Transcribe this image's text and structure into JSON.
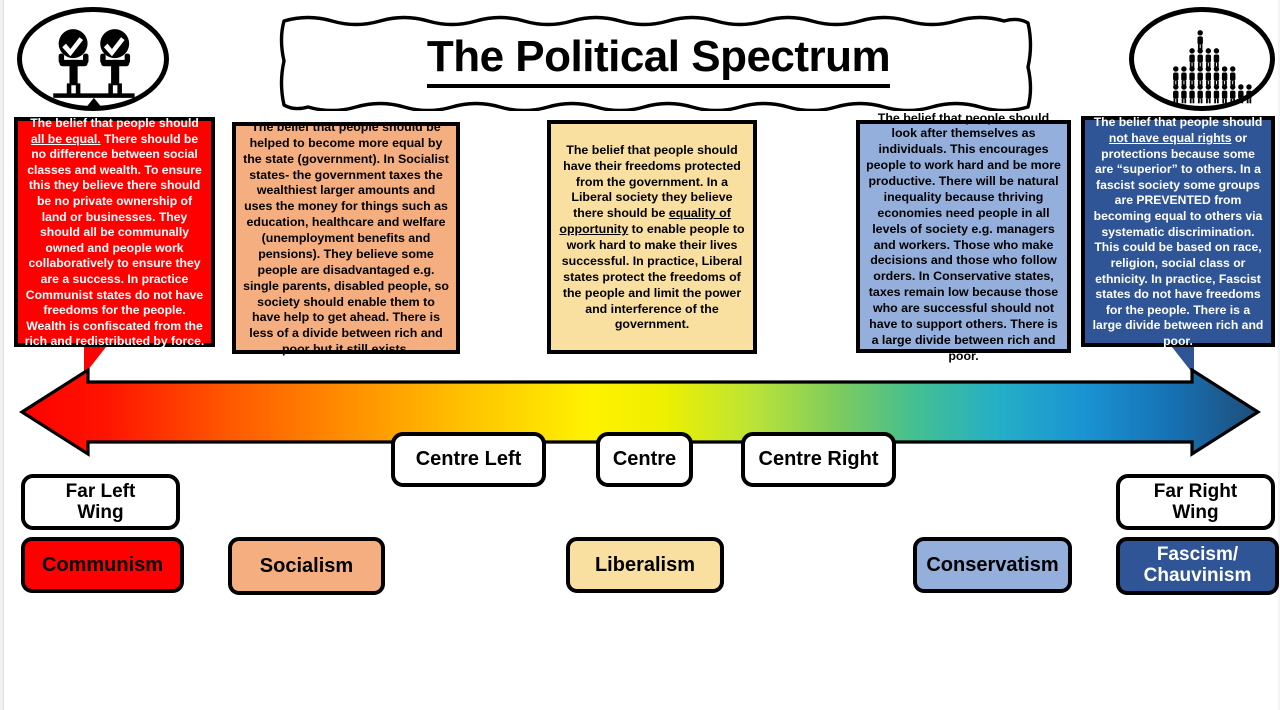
{
  "header": {
    "title": "The Political Spectrum",
    "left_icon": "equality-scales-icon",
    "right_icon": "social-hierarchy-pyramid-icon"
  },
  "descriptions": [
    {
      "id": "communism",
      "color": "#FF0000",
      "text_color": "#FFFFFF",
      "underlined_phrase": "all be equal.",
      "lead": "The belief that people should ",
      "rest": " There should be no difference between social classes and wealth. To ensure this they believe there should be no private ownership of land or businesses. They should all be communally owned and people work collaboratively to ensure they are a success. In practice Communist states do not have freedoms for the people. Wealth is confiscated from the rich and redistributed by force."
    },
    {
      "id": "socialism",
      "color": "#F4AE7F",
      "text_color": "#000000",
      "underlined_phrase": "",
      "lead": "The belief that people should be helped to become more equal by the state (government). In Socialist states- the government taxes the wealthiest larger amounts and uses the money for things such as education, healthcare and welfare (unemployment benefits and pensions). They believe some people are disadvantaged e.g. single parents, disabled people, so society should enable them to have help to get ahead. There is less of a divide between rich and poor but it still exists.",
      "rest": ""
    },
    {
      "id": "liberalism",
      "color": "#F9E0A0",
      "text_color": "#000000",
      "underlined_phrase": "equality of opportunity",
      "lead": "The belief that people should have their freedoms protected from the government. In a Liberal society they believe there should be ",
      "rest": " to enable people to work hard to make their lives successful. In practice, Liberal states protect the freedoms of the people and limit the power and interference of the government."
    },
    {
      "id": "conservatism",
      "color": "#94AFDB",
      "text_color": "#000000",
      "underlined_phrase": "",
      "lead": "The belief that people should look after themselves as individuals. This encourages people to work hard and be more productive. There will be natural inequality because thriving economies need people in all levels of society e.g. managers and workers. Those who make decisions and those who follow orders. In Conservative states, taxes remain low because those who are successful should not have to support others. There is a large divide between rich and poor.",
      "rest": ""
    },
    {
      "id": "fascism",
      "color": "#2F5597",
      "text_color": "#FFFFFF",
      "underlined_phrase": "not have equal rights",
      "lead": "The belief that people should ",
      "rest": " or protections because some are “superior” to others. In a fascist society some groups are PREVENTED from becoming equal to others via systematic discrimination. This could be based on race, religion, social class or ethnicity. In practice, Fascist states do not have freedoms for the people. There is a large divide between rich and poor."
    }
  ],
  "spectrum": {
    "type": "double-headed-arrow",
    "gradient_stops": [
      "#FF0000",
      "#FF2000",
      "#FF7A00",
      "#FFB400",
      "#FFE400",
      "#FAF400",
      "#C8E82E",
      "#79C85B",
      "#3FBF96",
      "#24AEC8",
      "#1B8FD0",
      "#1565A8",
      "#1F4E79"
    ],
    "left_end_label": "far-left",
    "right_end_label": "far-right"
  },
  "position_labels": {
    "far_left": "Far Left\nWing",
    "far_left_line1": "Far Left",
    "far_left_line2": "Wing",
    "centre_left": "Centre Left",
    "centre": "Centre",
    "centre_right": "Centre Right",
    "far_right_line1": "Far Right",
    "far_right_line2": "Wing"
  },
  "ideologies": [
    {
      "label": "Communism",
      "color": "#FF0000",
      "text_color": "#000000"
    },
    {
      "label": "Socialism",
      "color": "#F4AE7F",
      "text_color": "#000000"
    },
    {
      "label": "Liberalism",
      "color": "#F9E0A0",
      "text_color": "#000000"
    },
    {
      "label": "Conservatism",
      "color": "#94AFDB",
      "text_color": "#000000"
    },
    {
      "label": "Fascism/",
      "label2": "Chauvinism",
      "color": "#2F5597",
      "text_color": "#FFFFFF"
    }
  ]
}
